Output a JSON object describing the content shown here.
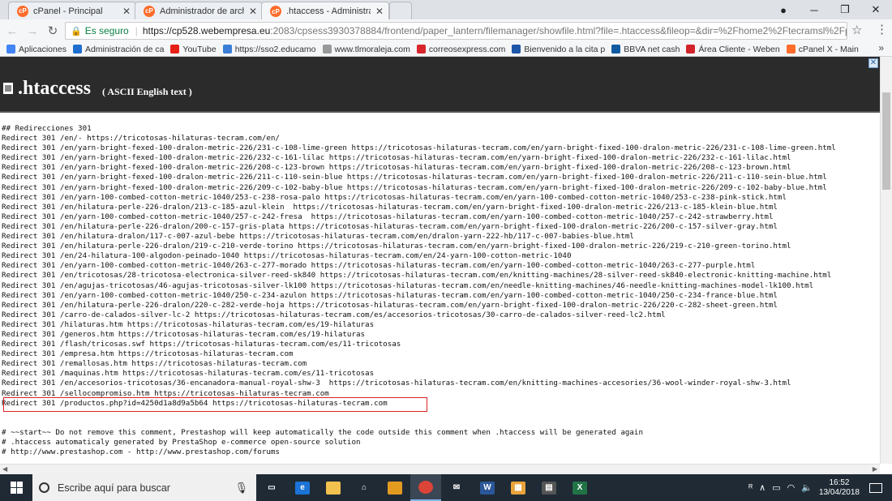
{
  "browser": {
    "tabs": [
      {
        "title": "cPanel - Principal",
        "favicon": "cP"
      },
      {
        "title": "Administrador de archivos",
        "favicon": "cP"
      },
      {
        "title": ".htaccess - Administrador",
        "favicon": "cP"
      }
    ],
    "secure_label": "Es seguro",
    "url_host": "https://cp528.webempresa.eu",
    "url_rest": ":2083/cpsess3930378884/frontend/paper_lantern/filemanager/showfile.html?file=.htaccess&fileop=&dir=%2Fhome2%2Ftecramsl%2Fpublic_html%..."
  },
  "bookmarks": [
    {
      "label": "Aplicaciones",
      "icon": "apps-grid-icon",
      "color": "#4285f4"
    },
    {
      "label": "Administración de ca",
      "icon": "blue-a-icon",
      "color": "#1f6fd1"
    },
    {
      "label": "YouTube",
      "icon": "youtube-icon",
      "color": "#e62117"
    },
    {
      "label": "https://sso2.educamo",
      "icon": "swirl-icon",
      "color": "#3a7ed6"
    },
    {
      "label": "www.tlmoraleja.com",
      "icon": "page-icon",
      "color": "#999999"
    },
    {
      "label": "correosexpress.com",
      "icon": "ex-icon",
      "color": "#d8262c"
    },
    {
      "label": "Bienvenido a la cita p",
      "icon": "cm-icon",
      "color": "#1e56a8"
    },
    {
      "label": "BBVA net cash",
      "icon": "bbva-icon",
      "color": "#0f5aa0"
    },
    {
      "label": "Área Cliente - Weben",
      "icon": "w-icon",
      "color": "#d2232a"
    },
    {
      "label": "cPanel X - Main",
      "icon": "cpanel-icon",
      "color": "#ff6c2c"
    }
  ],
  "page": {
    "title": ".htaccess",
    "subtitle": "( ASCII English text )"
  },
  "file_lines": [
    "## Redirecciones 301",
    "Redirect 301 /en/- https://tricotosas-hilaturas-tecram.com/en/",
    "Redirect 301 /en/yarn-bright-fexed-100-dralon-metric-226/231-c-108-lime-green https://tricotosas-hilaturas-tecram.com/en/yarn-bright-fixed-100-dralon-metric-226/231-c-108-lime-green.html",
    "Redirect 301 /en/yarn-bright-fexed-100-dralon-metric-226/232-c-161-lilac https://tricotosas-hilaturas-tecram.com/en/yarn-bright-fixed-100-dralon-metric-226/232-c-161-lilac.html",
    "Redirect 301 /en/yarn-bright-fexed-100-dralon-metric-226/208-c-123-brown https://tricotosas-hilaturas-tecram.com/en/yarn-bright-fixed-100-dralon-metric-226/208-c-123-brown.html",
    "Redirect 301 /en/yarn-bright-fexed-100-dralon-metric-226/211-c-110-sein-blue https://tricotosas-hilaturas-tecram.com/en/yarn-bright-fixed-100-dralon-metric-226/211-c-110-sein-blue.html",
    "Redirect 301 /en/yarn-bright-fexed-100-dralon-metric-226/209-c-102-baby-blue https://tricotosas-hilaturas-tecram.com/en/yarn-bright-fixed-100-dralon-metric-226/209-c-102-baby-blue.html",
    "Redirect 301 /en/yarn-100-combed-cotton-metric-1040/253-c-238-rosa-palo https://tricotosas-hilaturas-tecram.com/en/yarn-100-combed-cotton-metric-1040/253-c-238-pink-stick.html",
    "Redirect 301 /en/hilatura-perle-226-dralon/213-c-185-azul-klein  https://tricotosas-hilaturas-tecram.com/en/yarn-bright-fixed-100-dralon-metric-226/213-c-185-klein-blue.html",
    "Redirect 301 /en/yarn-100-combed-cotton-metric-1040/257-c-242-fresa  https://tricotosas-hilaturas-tecram.com/en/yarn-100-combed-cotton-metric-1040/257-c-242-strawberry.html",
    "Redirect 301 /en/hilatura-perle-226-dralon/200-c-157-gris-plata https://tricotosas-hilaturas-tecram.com/en/yarn-bright-fixed-100-dralon-metric-226/200-c-157-silver-gray.html",
    "Redirect 301 /en/hilatura-dralon/117-c-007-azul-bebe https://tricotosas-hilaturas-tecram.com/en/dralon-yarn-222-hb/117-c-007-babies-blue.html",
    "Redirect 301 /en/hilatura-perle-226-dralon/219-c-210-verde-torino https://tricotosas-hilaturas-tecram.com/en/yarn-bright-fixed-100-dralon-metric-226/219-c-210-green-torino.html",
    "Redirect 301 /en/24-hilatura-100-algodon-peinado-1040 https://tricotosas-hilaturas-tecram.com/en/24-yarn-100-cotton-metric-1040",
    "Redirect 301 /en/yarn-100-combed-cotton-metric-1040/263-c-277-morado https://tricotosas-hilaturas-tecram.com/en/yarn-100-combed-cotton-metric-1040/263-c-277-purple.html",
    "Redirect 301 /en/tricotosas/28-tricotosa-electronica-silver-reed-sk840 https://tricotosas-hilaturas-tecram.com/en/knitting-machines/28-silver-reed-sk840-electronic-knitting-machine.html",
    "Redirect 301 /en/agujas-tricotosas/46-agujas-tricotosas-silver-lk100 https://tricotosas-hilaturas-tecram.com/en/needle-knitting-machines/46-needle-knitting-machines-model-lk100.html",
    "Redirect 301 /en/yarn-100-combed-cotton-metric-1040/250-c-234-azulon https://tricotosas-hilaturas-tecram.com/en/yarn-100-combed-cotton-metric-1040/250-c-234-france-blue.html",
    "Redirect 301 /en/hilatura-perle-226-dralon/220-c-282-verde-hoja https://tricotosas-hilaturas-tecram.com/en/yarn-bright-fixed-100-dralon-metric-226/220-c-282-sheet-green.html",
    "Redirect 301 /carro-de-calados-silver-lc-2 https://tricotosas-hilaturas-tecram.com/es/accesorios-tricotosas/30-carro-de-calados-silver-reed-lc2.html",
    "Redirect 301 /hilaturas.htm https://tricotosas-hilaturas-tecram.com/es/19-hilaturas",
    "Redirect 301 /generos.htm https://tricotosas-hilaturas-tecram.com/es/19-hilaturas",
    "Redirect 301 /flash/tricosas.swf https://tricotosas-hilaturas-tecram.com/es/11-tricotosas",
    "Redirect 301 /empresa.htm https://tricotosas-hilaturas-tecram.com",
    "Redirect 301 /remallosas.htm https://tricotosas-hilaturas-tecram.com",
    "Redirect 301 /maquinas.htm https://tricotosas-hilaturas-tecram.com/es/11-tricotosas",
    "Redirect 301 /en/accesorios-tricotosas/36-encanadora-manual-royal-shw-3  https://tricotosas-hilaturas-tecram.com/en/knitting-machines-accesories/36-wool-winder-royal-shw-3.html",
    "Redirect 301 /sellocompromiso.htm https://tricotosas-hilaturas-tecram.com",
    "Redirect 301 /productos.php?id=4250d1a8d9a5b64 https://tricotosas-hilaturas-tecram.com",
    "",
    "",
    "# ~~start~~ Do not remove this comment, Prestashop will keep automatically the code outside this comment when .htaccess will be generated again",
    "# .htaccess automaticaly generated by PrestaShop e-commerce open-source solution",
    "# http://www.prestashop.com - http://www.prestashop.com/forums"
  ],
  "taskbar": {
    "search_placeholder": "Escribe aquí para buscar",
    "apps": [
      {
        "name": "task-view-icon",
        "glyph": "▭",
        "color": "transparent"
      },
      {
        "name": "edge-icon",
        "glyph": "e",
        "color": "#1b73d6"
      },
      {
        "name": "file-explorer-icon",
        "glyph": "",
        "color": "#f2c14e"
      },
      {
        "name": "home-icon",
        "glyph": "⌂",
        "color": "transparent"
      },
      {
        "name": "app-orange-icon",
        "glyph": "",
        "color": "#e39b1f"
      },
      {
        "name": "chrome-icon",
        "glyph": "",
        "color": "#db4437"
      },
      {
        "name": "mail-icon",
        "glyph": "✉",
        "color": "transparent"
      },
      {
        "name": "word-icon",
        "glyph": "W",
        "color": "#2b579a"
      },
      {
        "name": "store-icon",
        "glyph": "▦",
        "color": "#e8a33a"
      },
      {
        "name": "calculator-icon",
        "glyph": "▤",
        "color": "#555555"
      },
      {
        "name": "excel-icon",
        "glyph": "X",
        "color": "#217346"
      }
    ],
    "time": "16:52",
    "date": "13/04/2018"
  }
}
